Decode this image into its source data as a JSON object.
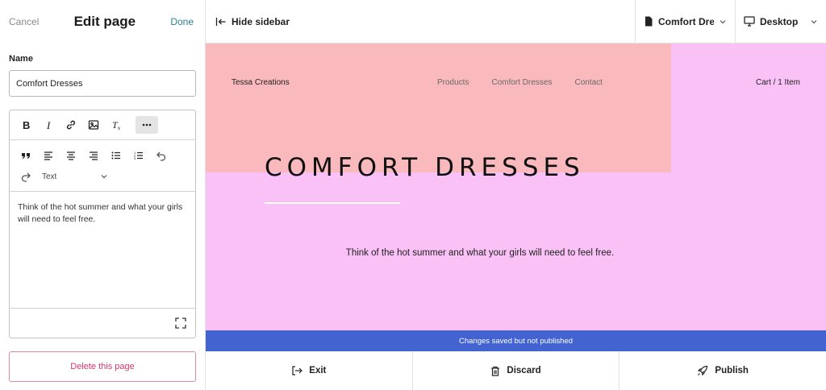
{
  "sidebar": {
    "cancel_label": "Cancel",
    "title": "Edit page",
    "done_label": "Done",
    "name_label": "Name",
    "name_value": "Comfort Dresses",
    "editor": {
      "format_value": "Text",
      "body_text": "Think of the hot summer and what your girls will need to feel free."
    },
    "delete_label": "Delete this page"
  },
  "topbar": {
    "hide_sidebar_label": "Hide sidebar",
    "page_select_value": "Comfort Dresses",
    "device_select_value": "Desktop"
  },
  "preview": {
    "brand": "Tessa Creations",
    "nav": [
      "Products",
      "Comfort Dresses",
      "Contact"
    ],
    "cart": "Cart / 1 Item",
    "hero_title": "COMFORT DRESSES",
    "hero_text": "Think of the hot summer and what your girls will need to feel free.",
    "colors": {
      "background": "#f9c1f6",
      "block": "#f9b9bd"
    }
  },
  "status_text": "Changes saved but not published",
  "actions": {
    "exit_label": "Exit",
    "discard_label": "Discard",
    "publish_label": "Publish"
  },
  "colors": {
    "accent": "#4263d0",
    "done": "#2a7f8a",
    "danger": "#d23a6a"
  }
}
